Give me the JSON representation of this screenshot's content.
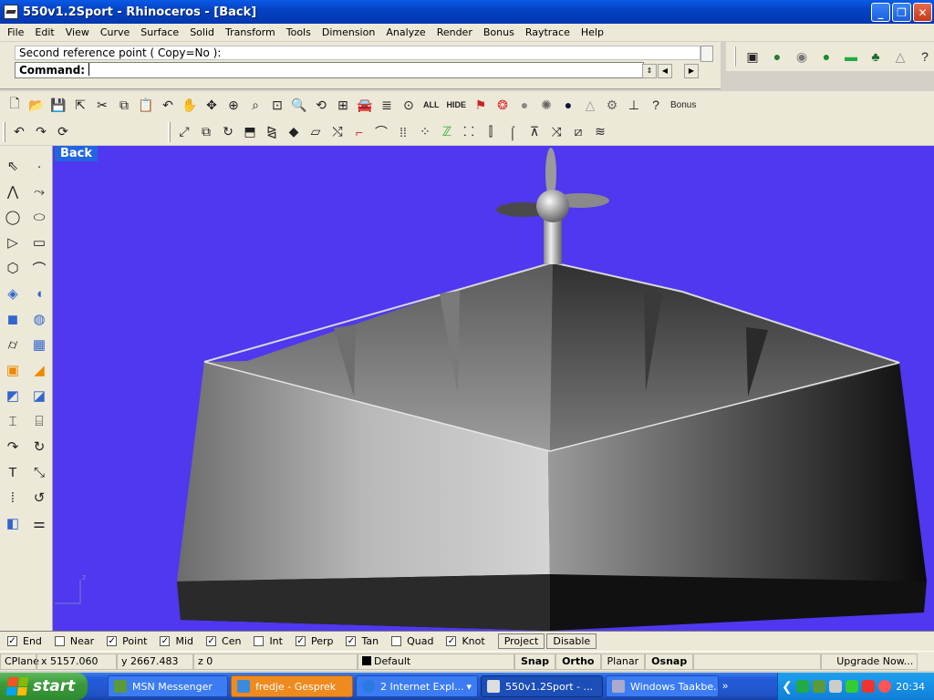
{
  "window": {
    "title": "550v1.2Sport - Rhinoceros - [Back]"
  },
  "menu": [
    "File",
    "Edit",
    "View",
    "Curve",
    "Surface",
    "Solid",
    "Transform",
    "Tools",
    "Dimension",
    "Analyze",
    "Render",
    "Bonus",
    "Raytrace",
    "Help"
  ],
  "command": {
    "history": "Second reference point ( Copy=No ):",
    "label": "Command:",
    "value": ""
  },
  "toolbar": {
    "all_label": "ALL",
    "hide_label": "HIDE",
    "bonus_label": "Bonus"
  },
  "viewport": {
    "label": "Back",
    "axis_label": "z",
    "background": "#4f38f0"
  },
  "osnaps": [
    {
      "label": "End",
      "checked": true
    },
    {
      "label": "Near",
      "checked": false
    },
    {
      "label": "Point",
      "checked": true
    },
    {
      "label": "Mid",
      "checked": true
    },
    {
      "label": "Cen",
      "checked": true
    },
    {
      "label": "Int",
      "checked": false
    },
    {
      "label": "Perp",
      "checked": true
    },
    {
      "label": "Tan",
      "checked": true
    },
    {
      "label": "Quad",
      "checked": false
    },
    {
      "label": "Knot",
      "checked": true
    }
  ],
  "osnap_buttons": {
    "project": "Project",
    "disable": "Disable"
  },
  "status": {
    "cplane": "CPlane",
    "x": "x 5157.060",
    "y": "y 2667.483",
    "z": "z 0",
    "layer": "Default",
    "snap": "Snap",
    "ortho": "Ortho",
    "planar": "Planar",
    "osnap": "Osnap",
    "upgrade": "Upgrade Now..."
  },
  "taskbar": {
    "start": "start",
    "items": [
      {
        "label": "MSN Messenger",
        "state": "normal"
      },
      {
        "label": "fredje - Gesprek",
        "state": "flash"
      },
      {
        "label": "2 Internet Expl...",
        "state": "normal"
      },
      {
        "label": "550v1.2Sport - ...",
        "state": "active"
      },
      {
        "label": "Windows Taakbe...",
        "state": "normal"
      }
    ],
    "clock": "20:34"
  }
}
